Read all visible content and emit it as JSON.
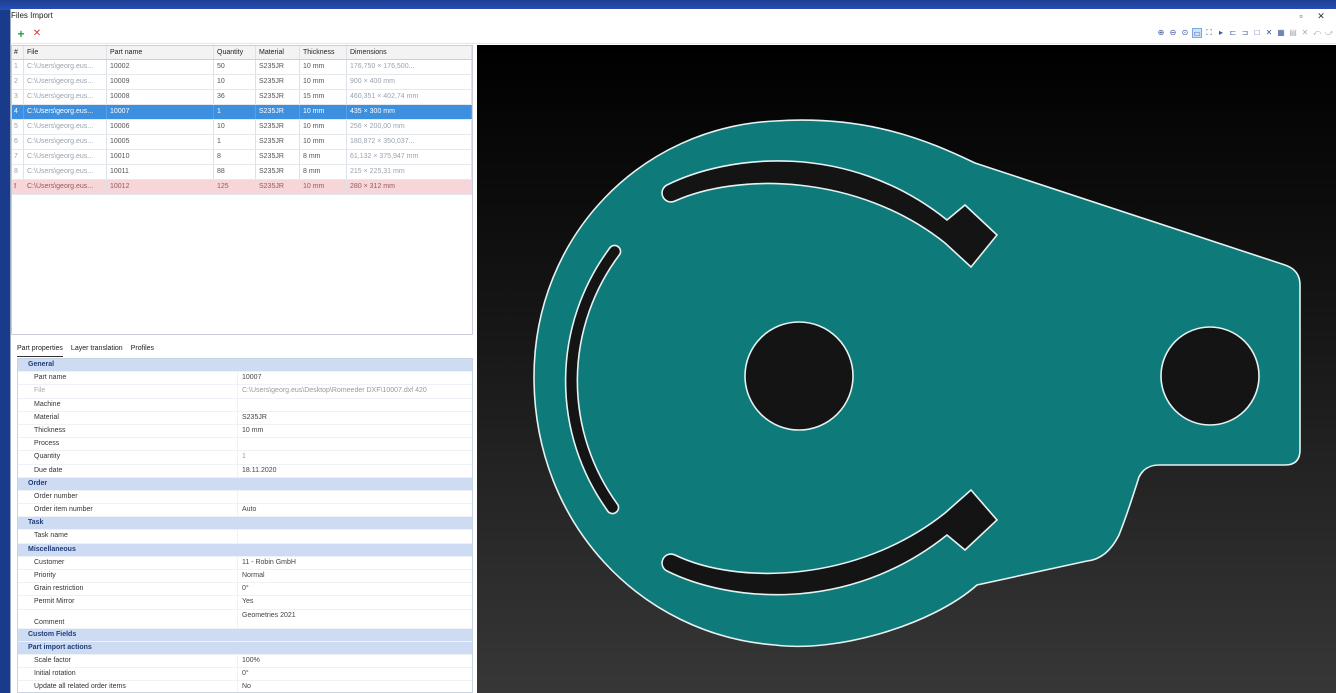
{
  "window": {
    "title": "Files Import",
    "minimize_glyph": "▫",
    "close_glyph": "✕"
  },
  "toolbar": {
    "add_icon": "plus-icon",
    "remove_icon": "remove-icon",
    "view_tools": [
      "zoom-in-icon",
      "zoom-out-icon",
      "zoom-fit-icon",
      "select-icon",
      "expand-icon",
      "play-icon",
      "align-left-icon",
      "align-right-icon",
      "frame-icon",
      "close-x-icon",
      "layout-icon",
      "grid-dim-icon",
      "tool-dim-icon",
      "tool-dim2-icon",
      "tool-dim3-icon"
    ]
  },
  "table": {
    "columns": [
      "#",
      "File",
      "Part name",
      "Quantity",
      "Material",
      "Thickness",
      "Dimensions"
    ],
    "rows": [
      {
        "num": "1",
        "file": "C:\\Users\\georg.eus...",
        "part": "10002",
        "qty": "50",
        "mat": "S235JR",
        "thk": "10 mm",
        "dim": "176,750 × 176,500..."
      },
      {
        "num": "2",
        "file": "C:\\Users\\georg.eus...",
        "part": "10009",
        "qty": "10",
        "mat": "S235JR",
        "thk": "10 mm",
        "dim": "900 × 400 mm"
      },
      {
        "num": "3",
        "file": "C:\\Users\\georg.eus...",
        "part": "10008",
        "qty": "36",
        "mat": "S235JR",
        "thk": "15 mm",
        "dim": "460,351 × 402,74 mm"
      },
      {
        "num": "4",
        "file": "C:\\Users\\georg.eus...",
        "part": "10007",
        "qty": "1",
        "mat": "S235JR",
        "thk": "10 mm",
        "dim": "435 × 300 mm"
      },
      {
        "num": "5",
        "file": "C:\\Users\\georg.eus...",
        "part": "10006",
        "qty": "10",
        "mat": "S235JR",
        "thk": "10 mm",
        "dim": "256 × 200,00 mm"
      },
      {
        "num": "6",
        "file": "C:\\Users\\georg.eus...",
        "part": "10005",
        "qty": "1",
        "mat": "S235JR",
        "thk": "10 mm",
        "dim": "180,872 × 350,037..."
      },
      {
        "num": "7",
        "file": "C:\\Users\\georg.eus...",
        "part": "10010",
        "qty": "8",
        "mat": "S235JR",
        "thk": "8 mm",
        "dim": "61,132 × 375,947 mm"
      },
      {
        "num": "8",
        "file": "C:\\Users\\georg.eus...",
        "part": "10011",
        "qty": "88",
        "mat": "S235JR",
        "thk": "8 mm",
        "dim": "215 × 225,31 mm"
      },
      {
        "num": "!",
        "file": "C:\\Users\\georg.eus...",
        "part": "10012",
        "qty": "125",
        "mat": "S235JR",
        "thk": "10 mm",
        "dim": "280 × 312 mm"
      }
    ]
  },
  "tabs": [
    "Part properties",
    "Layer translation",
    "Profiles"
  ],
  "properties": {
    "general_label": "General",
    "part_name": {
      "k": "Part name",
      "v": "10007"
    },
    "file": {
      "k": "File",
      "v": "C:\\Users\\georg.eus\\Desktop\\Romeeder DXF\\10007.dxf 420"
    },
    "machine": {
      "k": "Machine",
      "v": ""
    },
    "material": {
      "k": "Material",
      "v": "S235JR"
    },
    "thickness": {
      "k": "Thickness",
      "v": "10 mm"
    },
    "process": {
      "k": "Process",
      "v": ""
    },
    "quantity": {
      "k": "Quantity",
      "v": "1"
    },
    "due_date": {
      "k": "Due date",
      "v": "18.11.2020"
    },
    "order_label": "Order",
    "order_number": {
      "k": "Order number",
      "v": ""
    },
    "order_item_number": {
      "k": "Order item number",
      "v": "Auto"
    },
    "task_label": "Task",
    "task_name": {
      "k": "Task name",
      "v": ""
    },
    "misc_label": "Miscellaneous",
    "customer": {
      "k": "Customer",
      "v": "11 - Robin GmbH"
    },
    "priority": {
      "k": "Priority",
      "v": "Normal"
    },
    "grain": {
      "k": "Grain restriction",
      "v": "0°"
    },
    "permit_mirror": {
      "k": "Permit Mirror",
      "v": "Yes"
    },
    "comment": {
      "k": "Comment",
      "v": "Geometries 2021"
    },
    "custom_label": "Custom Fields",
    "import_label": "Part import actions",
    "scale": {
      "k": "Scale factor",
      "v": "100%"
    },
    "rotation": {
      "k": "Initial rotation",
      "v": "0°"
    },
    "update": {
      "k": "Update all related order items",
      "v": "No"
    }
  },
  "viewport": {
    "part_color": "#0f7a7a",
    "outline_color": "#e6f2f2",
    "background": "#141414"
  }
}
